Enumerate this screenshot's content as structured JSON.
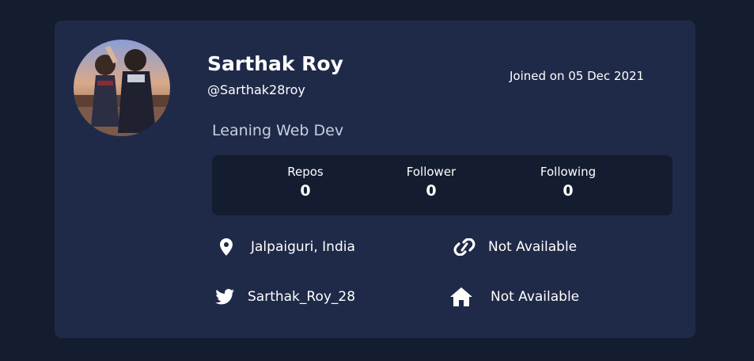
{
  "profile": {
    "name": "Sarthak Roy",
    "handle": "@Sarthak28roy",
    "joined": "Joined on 05 Dec 2021",
    "bio": "Leaning Web Dev"
  },
  "stats": [
    {
      "label": "Repos",
      "value": "0"
    },
    {
      "label": "Follower",
      "value": "0"
    },
    {
      "label": "Following",
      "value": "0"
    }
  ],
  "info": {
    "location": {
      "icon": "location-pin-icon",
      "text": "Jalpaiguri, India"
    },
    "website": {
      "icon": "link-icon",
      "text": "Not Available"
    },
    "twitter": {
      "icon": "twitter-icon",
      "text": "Sarthak_Roy_28"
    },
    "company": {
      "icon": "home-icon",
      "text": "Not Available"
    }
  },
  "colors": {
    "page_background": "#141c2f",
    "card_background": "#1f2a48",
    "stats_background": "#141c2f",
    "text": "#ffffff",
    "bio_text": "#c7cfe0"
  }
}
